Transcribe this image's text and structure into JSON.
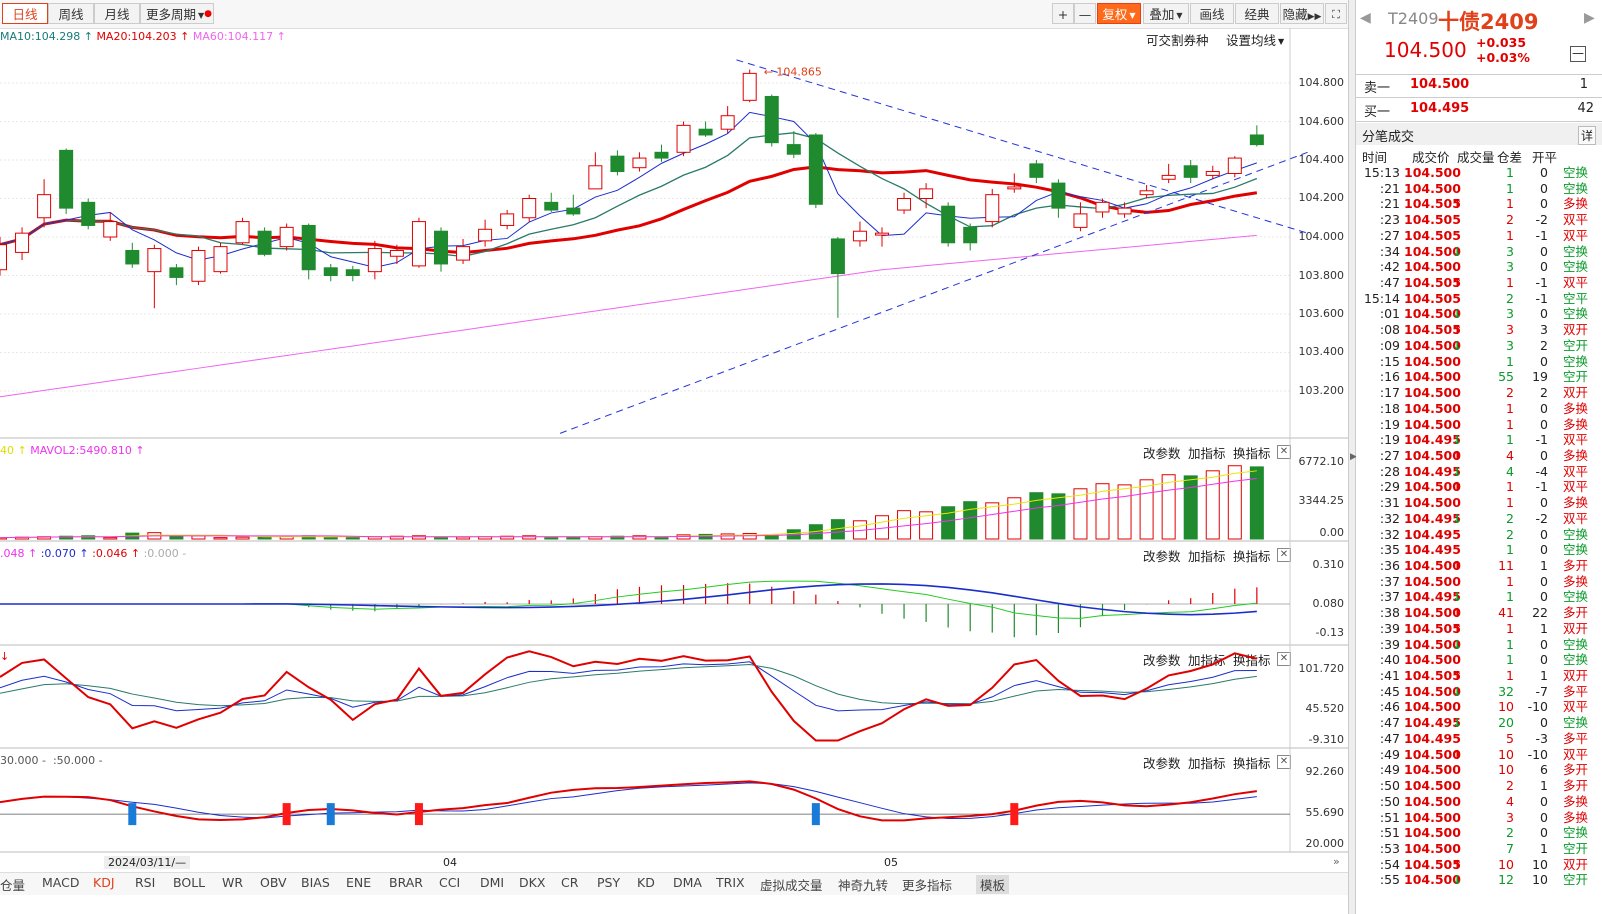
{
  "toolbar": {
    "tabs": [
      "日线",
      "周线",
      "月线",
      "更多周期"
    ],
    "active_tab": "日线",
    "zoom_in": "+",
    "zoom_out": "—",
    "fuquan": "复权",
    "diejia": "叠加",
    "huaxian": "画线",
    "jingdian": "经典",
    "yincang": "隐藏"
  },
  "main_panel": {
    "ma_labels": [
      "MA10:104.298",
      "MA20:104.203",
      "MA60:104.117"
    ],
    "option1": "可交割券种",
    "option2": "设置均线",
    "peak_label": "104.865",
    "y_ticks": [
      "104.800",
      "104.600",
      "104.400",
      "104.200",
      "104.000",
      "103.800",
      "103.600",
      "103.400",
      "103.200"
    ]
  },
  "sub_panels": [
    {
      "label": "40",
      "label2": "MAVOL2:5490.810",
      "ticks": [
        "6772.10",
        "3344.25",
        "0.00"
      ]
    },
    {
      "label": ".048",
      "label2": ":0.070",
      "label3": ":0.046",
      "label4": ":0.000 -",
      "ticks": [
        "0.310",
        "0.080",
        "-0.13"
      ]
    },
    {
      "label": "",
      "ticks": [
        "101.720",
        "45.520",
        "-9.310"
      ]
    },
    {
      "label": "30.000 -",
      "label2": ":50.000 -",
      "ticks": [
        "92.260",
        "55.690",
        "20.000"
      ]
    }
  ],
  "sub_panel_options": {
    "p1": "改参数",
    "p2": "加指标",
    "p3": "换指标"
  },
  "date_axis": {
    "first": "2024/03/11/—",
    "m04": "04",
    "m05": "05"
  },
  "bottom_tabs": [
    "仓量",
    "MACD",
    "KDJ",
    "RSI",
    "BOLL",
    "WR",
    "OBV",
    "BIAS",
    "ENE",
    "BRAR",
    "CCI",
    "DMI",
    "DKX",
    "CR",
    "PSY",
    "KD",
    "DMA",
    "TRIX",
    "虚拟成交量",
    "神奇九转",
    "更多指标",
    "模板"
  ],
  "active_bottom_tab": "KDJ",
  "right_panel": {
    "code": "T2409",
    "name": "十债2409",
    "price": "104.500",
    "change": "+0.035",
    "change_pct": "+0.03%",
    "sell_label": "卖一",
    "sell_price": "104.500",
    "sell_vol": "1",
    "buy_label": "买一",
    "buy_price": "104.495",
    "buy_vol": "42",
    "trade_title": "分笔成交",
    "detail": "详",
    "headers": {
      "time": "时间",
      "price": "成交价",
      "vol": "成交量",
      "oi": "仓差",
      "type": "开平"
    }
  },
  "trades": [
    {
      "t": "15:13",
      "p": "104.500",
      "a": "",
      "v": "1",
      "oi": "0",
      "ty": "空换"
    },
    {
      "t": ":21",
      "p": "104.500",
      "a": "",
      "v": "1",
      "oi": "0",
      "ty": "空换"
    },
    {
      "t": ":21",
      "p": "104.505",
      "a": "↑",
      "v": "1",
      "oi": "0",
      "ty": "多换"
    },
    {
      "t": ":23",
      "p": "104.505",
      "a": "",
      "v": "2",
      "oi": "-2",
      "ty": "双平"
    },
    {
      "t": ":27",
      "p": "104.505",
      "a": "",
      "v": "1",
      "oi": "-1",
      "ty": "双平"
    },
    {
      "t": ":34",
      "p": "104.500",
      "a": "↓",
      "v": "3",
      "oi": "0",
      "ty": "空换"
    },
    {
      "t": ":42",
      "p": "104.500",
      "a": "",
      "v": "3",
      "oi": "0",
      "ty": "空换"
    },
    {
      "t": ":47",
      "p": "104.505",
      "a": "↑",
      "v": "1",
      "oi": "-1",
      "ty": "双平"
    },
    {
      "t": "15:14",
      "p": "104.505",
      "a": "",
      "v": "2",
      "oi": "-1",
      "ty": "空平"
    },
    {
      "t": ":01",
      "p": "104.500",
      "a": "↓",
      "v": "3",
      "oi": "0",
      "ty": "空换"
    },
    {
      "t": ":08",
      "p": "104.505",
      "a": "↑",
      "v": "3",
      "oi": "3",
      "ty": "双开"
    },
    {
      "t": ":09",
      "p": "104.500",
      "a": "↓",
      "v": "3",
      "oi": "2",
      "ty": "空开"
    },
    {
      "t": ":15",
      "p": "104.500",
      "a": "",
      "v": "1",
      "oi": "0",
      "ty": "空换"
    },
    {
      "t": ":16",
      "p": "104.500",
      "a": "",
      "v": "55",
      "oi": "19",
      "ty": "空开"
    },
    {
      "t": ":17",
      "p": "104.500",
      "a": "",
      "v": "2",
      "oi": "2",
      "ty": "双开"
    },
    {
      "t": ":18",
      "p": "104.500",
      "a": "",
      "v": "1",
      "oi": "0",
      "ty": "多换"
    },
    {
      "t": ":19",
      "p": "104.500",
      "a": "",
      "v": "1",
      "oi": "0",
      "ty": "多换"
    },
    {
      "t": ":19",
      "p": "104.495",
      "a": "↓",
      "v": "1",
      "oi": "-1",
      "ty": "双平"
    },
    {
      "t": ":27",
      "p": "104.500",
      "a": "↑",
      "v": "4",
      "oi": "0",
      "ty": "多换"
    },
    {
      "t": ":28",
      "p": "104.495",
      "a": "↓",
      "v": "4",
      "oi": "-4",
      "ty": "双平"
    },
    {
      "t": ":29",
      "p": "104.500",
      "a": "↑",
      "v": "1",
      "oi": "-1",
      "ty": "双平"
    },
    {
      "t": ":31",
      "p": "104.500",
      "a": "",
      "v": "1",
      "oi": "0",
      "ty": "多换"
    },
    {
      "t": ":32",
      "p": "104.495",
      "a": "↓",
      "v": "2",
      "oi": "-2",
      "ty": "双平"
    },
    {
      "t": ":32",
      "p": "104.495",
      "a": "",
      "v": "2",
      "oi": "0",
      "ty": "空换"
    },
    {
      "t": ":35",
      "p": "104.495",
      "a": "",
      "v": "1",
      "oi": "0",
      "ty": "空换"
    },
    {
      "t": ":36",
      "p": "104.500",
      "a": "↑",
      "v": "11",
      "oi": "1",
      "ty": "多开"
    },
    {
      "t": ":37",
      "p": "104.500",
      "a": "",
      "v": "1",
      "oi": "0",
      "ty": "多换"
    },
    {
      "t": ":37",
      "p": "104.495",
      "a": "↓",
      "v": "1",
      "oi": "0",
      "ty": "空换"
    },
    {
      "t": ":38",
      "p": "104.500",
      "a": "↑",
      "v": "41",
      "oi": "22",
      "ty": "多开"
    },
    {
      "t": ":39",
      "p": "104.505",
      "a": "↑",
      "v": "1",
      "oi": "1",
      "ty": "双开"
    },
    {
      "t": ":39",
      "p": "104.500",
      "a": "↓",
      "v": "1",
      "oi": "0",
      "ty": "空换"
    },
    {
      "t": ":40",
      "p": "104.500",
      "a": "",
      "v": "1",
      "oi": "0",
      "ty": "空换"
    },
    {
      "t": ":41",
      "p": "104.505",
      "a": "↑",
      "v": "1",
      "oi": "1",
      "ty": "双开"
    },
    {
      "t": ":45",
      "p": "104.500",
      "a": "↓",
      "v": "32",
      "oi": "-7",
      "ty": "多平"
    },
    {
      "t": ":46",
      "p": "104.500",
      "a": "",
      "v": "10",
      "oi": "-10",
      "ty": "双平"
    },
    {
      "t": ":47",
      "p": "104.495",
      "a": "↓",
      "v": "20",
      "oi": "0",
      "ty": "空换"
    },
    {
      "t": ":47",
      "p": "104.495",
      "a": "",
      "v": "5",
      "oi": "-3",
      "ty": "多平"
    },
    {
      "t": ":49",
      "p": "104.500",
      "a": "↑",
      "v": "10",
      "oi": "-10",
      "ty": "双平"
    },
    {
      "t": ":49",
      "p": "104.500",
      "a": "",
      "v": "10",
      "oi": "6",
      "ty": "多开"
    },
    {
      "t": ":50",
      "p": "104.500",
      "a": "",
      "v": "2",
      "oi": "1",
      "ty": "多开"
    },
    {
      "t": ":50",
      "p": "104.500",
      "a": "",
      "v": "4",
      "oi": "0",
      "ty": "多换"
    },
    {
      "t": ":51",
      "p": "104.500",
      "a": "",
      "v": "3",
      "oi": "0",
      "ty": "多换"
    },
    {
      "t": ":51",
      "p": "104.500",
      "a": "",
      "v": "2",
      "oi": "0",
      "ty": "空换"
    },
    {
      "t": ":53",
      "p": "104.500",
      "a": "",
      "v": "7",
      "oi": "1",
      "ty": "空开"
    },
    {
      "t": ":54",
      "p": "104.505",
      "a": "↑",
      "v": "10",
      "oi": "10",
      "ty": "双开"
    },
    {
      "t": ":55",
      "p": "104.500",
      "a": "↓",
      "v": "12",
      "oi": "10",
      "ty": "空开"
    }
  ],
  "colors": {
    "up": "#e00000",
    "down": "#1f8a2e",
    "accent": "#e0401a",
    "ma10": "#1a2ecc",
    "ma20": "#e00000",
    "ma60": "#ee66ee",
    "mavol1": "#e8e800"
  },
  "chart_data": {
    "type": "candlestick",
    "ylim": [
      103.1,
      104.95
    ],
    "candles": [
      {
        "o": 103.83,
        "c": 103.96,
        "h": 104.0,
        "l": 103.8
      },
      {
        "o": 103.92,
        "c": 104.02,
        "h": 104.05,
        "l": 103.88
      },
      {
        "o": 104.1,
        "c": 104.22,
        "h": 104.3,
        "l": 104.05
      },
      {
        "o": 104.45,
        "c": 104.15,
        "h": 104.46,
        "l": 104.12
      },
      {
        "o": 104.18,
        "c": 104.06,
        "h": 104.2,
        "l": 104.04
      },
      {
        "o": 104.0,
        "c": 104.08,
        "h": 104.13,
        "l": 103.98
      },
      {
        "o": 103.93,
        "c": 103.86,
        "h": 103.97,
        "l": 103.84
      },
      {
        "o": 103.82,
        "c": 103.94,
        "h": 103.96,
        "l": 103.63
      },
      {
        "o": 103.84,
        "c": 103.79,
        "h": 103.86,
        "l": 103.75
      },
      {
        "o": 103.77,
        "c": 103.93,
        "h": 103.95,
        "l": 103.75
      },
      {
        "o": 103.82,
        "c": 103.95,
        "h": 103.97,
        "l": 103.81
      },
      {
        "o": 103.97,
        "c": 104.08,
        "h": 104.1,
        "l": 103.96
      },
      {
        "o": 104.03,
        "c": 103.91,
        "h": 104.05,
        "l": 103.9
      },
      {
        "o": 103.95,
        "c": 104.05,
        "h": 104.07,
        "l": 103.93
      },
      {
        "o": 104.06,
        "c": 103.83,
        "h": 104.07,
        "l": 103.78
      },
      {
        "o": 103.84,
        "c": 103.8,
        "h": 103.86,
        "l": 103.77
      },
      {
        "o": 103.83,
        "c": 103.8,
        "h": 103.85,
        "l": 103.77
      },
      {
        "o": 103.82,
        "c": 103.94,
        "h": 103.98,
        "l": 103.78
      },
      {
        "o": 103.9,
        "c": 103.93,
        "h": 103.96,
        "l": 103.86
      },
      {
        "o": 103.85,
        "c": 104.08,
        "h": 104.1,
        "l": 103.84
      },
      {
        "o": 104.03,
        "c": 103.86,
        "h": 104.05,
        "l": 103.82
      },
      {
        "o": 103.88,
        "c": 103.95,
        "h": 103.99,
        "l": 103.86
      },
      {
        "o": 103.98,
        "c": 104.04,
        "h": 104.09,
        "l": 103.95
      },
      {
        "o": 104.06,
        "c": 104.12,
        "h": 104.14,
        "l": 104.04
      },
      {
        "o": 104.1,
        "c": 104.2,
        "h": 104.22,
        "l": 104.08
      },
      {
        "o": 104.18,
        "c": 104.14,
        "h": 104.23,
        "l": 104.13
      },
      {
        "o": 104.15,
        "c": 104.12,
        "h": 104.22,
        "l": 104.11
      },
      {
        "o": 104.25,
        "c": 104.37,
        "h": 104.44,
        "l": 104.25
      },
      {
        "o": 104.42,
        "c": 104.34,
        "h": 104.45,
        "l": 104.32
      },
      {
        "o": 104.36,
        "c": 104.41,
        "h": 104.44,
        "l": 104.34
      },
      {
        "o": 104.44,
        "c": 104.41,
        "h": 104.48,
        "l": 104.39
      },
      {
        "o": 104.44,
        "c": 104.58,
        "h": 104.6,
        "l": 104.42
      },
      {
        "o": 104.56,
        "c": 104.53,
        "h": 104.6,
        "l": 104.52
      },
      {
        "o": 104.56,
        "c": 104.63,
        "h": 104.68,
        "l": 104.54
      },
      {
        "o": 104.71,
        "c": 104.85,
        "h": 104.87,
        "l": 104.7
      },
      {
        "o": 104.73,
        "c": 104.49,
        "h": 104.74,
        "l": 104.47
      },
      {
        "o": 104.48,
        "c": 104.43,
        "h": 104.55,
        "l": 104.41
      },
      {
        "o": 104.53,
        "c": 104.17,
        "h": 104.54,
        "l": 104.15
      },
      {
        "o": 103.99,
        "c": 103.81,
        "h": 104.0,
        "l": 103.58
      },
      {
        "o": 103.98,
        "c": 104.03,
        "h": 104.08,
        "l": 103.95
      },
      {
        "o": 104.01,
        "c": 104.02,
        "h": 104.05,
        "l": 103.95
      },
      {
        "o": 104.14,
        "c": 104.2,
        "h": 104.23,
        "l": 104.12
      },
      {
        "o": 104.2,
        "c": 104.25,
        "h": 104.28,
        "l": 104.15
      },
      {
        "o": 104.16,
        "c": 103.97,
        "h": 104.18,
        "l": 103.95
      },
      {
        "o": 104.05,
        "c": 103.97,
        "h": 104.07,
        "l": 103.93
      },
      {
        "o": 104.08,
        "c": 104.22,
        "h": 104.25,
        "l": 104.05
      },
      {
        "o": 104.25,
        "c": 104.26,
        "h": 104.33,
        "l": 104.23
      },
      {
        "o": 104.38,
        "c": 104.31,
        "h": 104.4,
        "l": 104.28
      },
      {
        "o": 104.28,
        "c": 104.15,
        "h": 104.3,
        "l": 104.1
      },
      {
        "o": 104.05,
        "c": 104.12,
        "h": 104.18,
        "l": 104.03
      },
      {
        "o": 104.13,
        "c": 104.18,
        "h": 104.2,
        "l": 104.1
      },
      {
        "o": 104.12,
        "c": 104.15,
        "h": 104.18,
        "l": 104.1
      },
      {
        "o": 104.22,
        "c": 104.24,
        "h": 104.27,
        "l": 104.2
      },
      {
        "o": 104.3,
        "c": 104.32,
        "h": 104.38,
        "l": 104.28
      },
      {
        "o": 104.37,
        "c": 104.31,
        "h": 104.4,
        "l": 104.28
      },
      {
        "o": 104.32,
        "c": 104.34,
        "h": 104.37,
        "l": 104.3
      },
      {
        "o": 104.33,
        "c": 104.41,
        "h": 104.42,
        "l": 104.31
      },
      {
        "o": 104.53,
        "c": 104.48,
        "h": 104.58,
        "l": 104.47
      }
    ],
    "trendlines": [
      {
        "name": "upper",
        "from": {
          "i": 33.4,
          "v": 104.92
        },
        "to": {
          "i": 59.3,
          "v": 104.02
        }
      },
      {
        "name": "lower",
        "from": {
          "i": 25.4,
          "v": 102.98
        },
        "to": {
          "i": 59.3,
          "v": 104.44
        }
      }
    ],
    "volume": {
      "ylim": [
        0,
        6772.1
      ],
      "ma_label": "MAVOL2:5490.810"
    },
    "kdj_marks_blue": [
      6,
      15,
      37
    ],
    "kdj_marks_red": [
      13,
      19,
      46
    ]
  }
}
